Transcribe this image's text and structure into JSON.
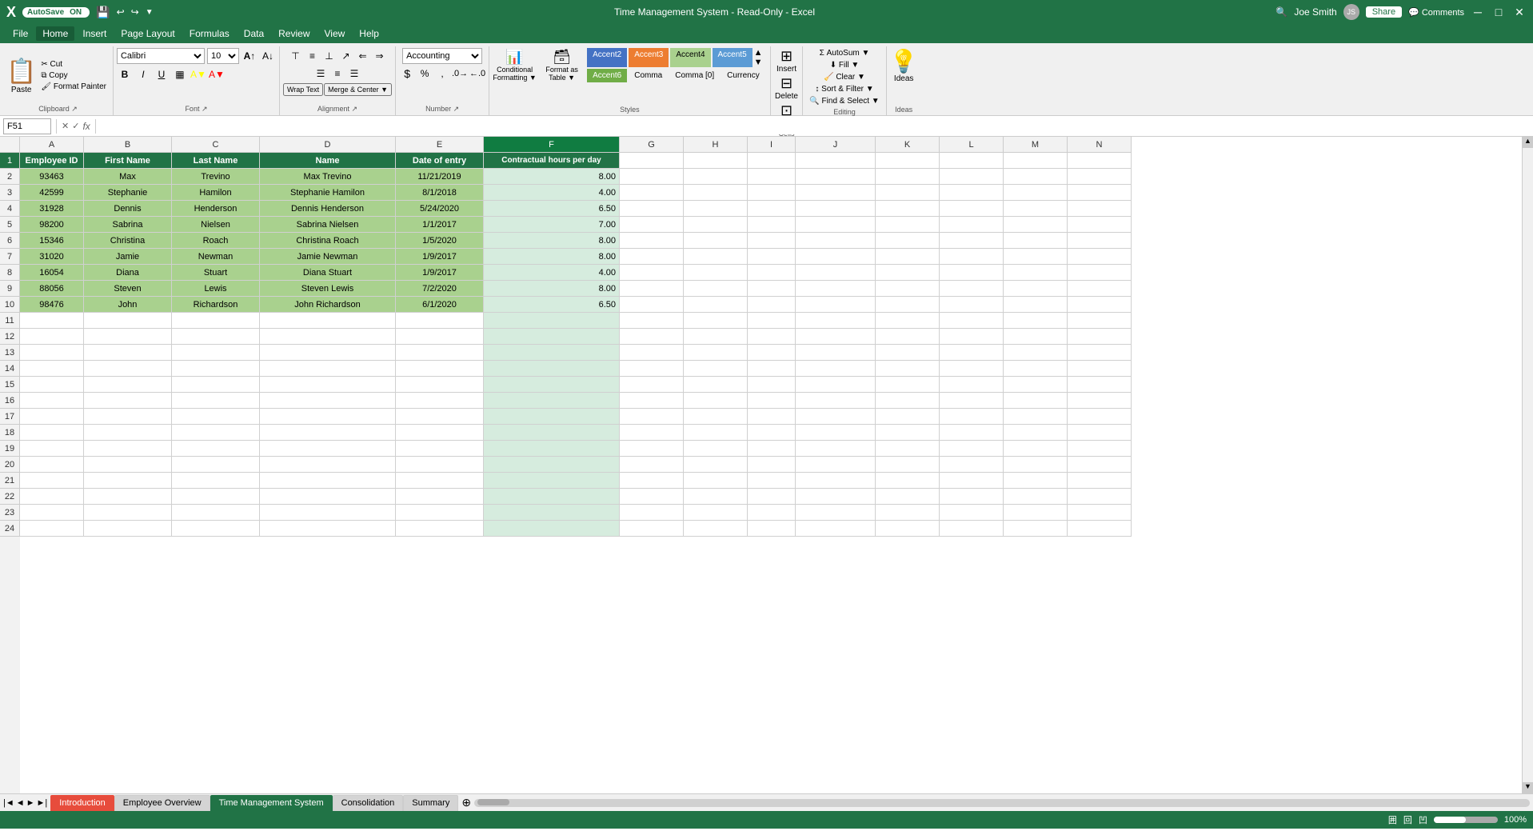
{
  "titleBar": {
    "autosave": "AutoSave",
    "autosaveState": "ON",
    "title": "Time Management System - Read-Only - Excel",
    "user": "Joe Smith",
    "winBtns": [
      "─",
      "□",
      "✕"
    ]
  },
  "menuBar": {
    "items": [
      "File",
      "Home",
      "Insert",
      "Page Layout",
      "Formulas",
      "Data",
      "Review",
      "View",
      "Help"
    ]
  },
  "ribbon": {
    "activeTab": "Home",
    "groups": {
      "clipboard": {
        "label": "Clipboard",
        "paste": "Paste",
        "cut": "✂ Cut",
        "copy": "⧉ Copy",
        "formatPainter": "🖌 Format Painter"
      },
      "font": {
        "label": "Font",
        "fontName": "Calibri",
        "fontSize": "10",
        "bold": "B",
        "italic": "I",
        "underline": "U"
      },
      "alignment": {
        "label": "Alignment",
        "wrapText": "Wrap Text",
        "mergeCenter": "Merge & Center"
      },
      "number": {
        "label": "Number",
        "format": "Accounting"
      },
      "styles": {
        "label": "Styles",
        "conditionalFormatting": "Conditional Formatting",
        "formatAsTable": "Format as Table",
        "accent2": "Accent2",
        "accent3": "Accent3",
        "accent4": "Accent4",
        "accent5": "Accent5",
        "accent6": "Accent6",
        "comma": "Comma",
        "comma0": "Comma [0]",
        "currency": "Currency"
      },
      "cells": {
        "label": "Cells",
        "insert": "Insert",
        "delete": "Delete",
        "format": "Format"
      },
      "editing": {
        "label": "Editing",
        "autoSum": "Σ AutoSum",
        "fill": "Fill ▼",
        "clear": "Clear ▼",
        "sortFilter": "Sort & Filter",
        "findSelect": "Find & Select"
      },
      "ideas": {
        "label": "Ideas",
        "ideas": "Ideas"
      }
    }
  },
  "formulaBar": {
    "cellRef": "F51",
    "formula": ""
  },
  "columns": {
    "widths": [
      80,
      110,
      110,
      170,
      110,
      170
    ],
    "letters": [
      "A",
      "B",
      "C",
      "D",
      "E",
      "F",
      "G",
      "H",
      "I",
      "J",
      "K",
      "L",
      "M",
      "N"
    ],
    "extraWidths": [
      80,
      80,
      60,
      100,
      80,
      80,
      80,
      80,
      80,
      80
    ]
  },
  "headers": {
    "row1": [
      "Employee ID",
      "First Name",
      "Last Name",
      "Name",
      "Date of entry",
      "Contractual hours per day"
    ]
  },
  "rows": [
    {
      "num": 2,
      "A": "93463",
      "B": "Max",
      "C": "Trevino",
      "D": "Max Trevino",
      "E": "11/21/2019",
      "F": "8.00"
    },
    {
      "num": 3,
      "A": "42599",
      "B": "Stephanie",
      "C": "Hamilon",
      "D": "Stephanie Hamilon",
      "E": "8/1/2018",
      "F": "4.00"
    },
    {
      "num": 4,
      "A": "31928",
      "B": "Dennis",
      "C": "Henderson",
      "D": "Dennis Henderson",
      "E": "5/24/2020",
      "F": "6.50"
    },
    {
      "num": 5,
      "A": "98200",
      "B": "Sabrina",
      "C": "Nielsen",
      "D": "Sabrina Nielsen",
      "E": "1/1/2017",
      "F": "7.00"
    },
    {
      "num": 6,
      "A": "15346",
      "B": "Christina",
      "C": "Roach",
      "D": "Christina Roach",
      "E": "1/5/2020",
      "F": "8.00"
    },
    {
      "num": 7,
      "A": "31020",
      "B": "Jamie",
      "C": "Newman",
      "D": "Jamie Newman",
      "E": "1/9/2017",
      "F": "8.00"
    },
    {
      "num": 8,
      "A": "16054",
      "B": "Diana",
      "C": "Stuart",
      "D": "Diana Stuart",
      "E": "1/9/2017",
      "F": "4.00"
    },
    {
      "num": 9,
      "A": "88056",
      "B": "Steven",
      "C": "Lewis",
      "D": "Steven Lewis",
      "E": "7/2/2020",
      "F": "8.00"
    },
    {
      "num": 10,
      "A": "98476",
      "B": "John",
      "C": "Richardson",
      "D": "John Richardson",
      "E": "6/1/2020",
      "F": "6.50"
    }
  ],
  "emptyRows": [
    11,
    12,
    13,
    14,
    15,
    16,
    17,
    18,
    19,
    20,
    21,
    22,
    23,
    24
  ],
  "tabs": [
    {
      "id": "intro",
      "label": "Introduction",
      "class": "tab-intro"
    },
    {
      "id": "emp",
      "label": "Employee Overview",
      "class": "tab-emp"
    },
    {
      "id": "time",
      "label": "Time Management System",
      "class": "tab-time"
    },
    {
      "id": "consol",
      "label": "Consolidation",
      "class": ""
    },
    {
      "id": "summary",
      "label": "Summary",
      "class": ""
    }
  ],
  "statusBar": {
    "left": "",
    "right": "囲 回 凹"
  }
}
